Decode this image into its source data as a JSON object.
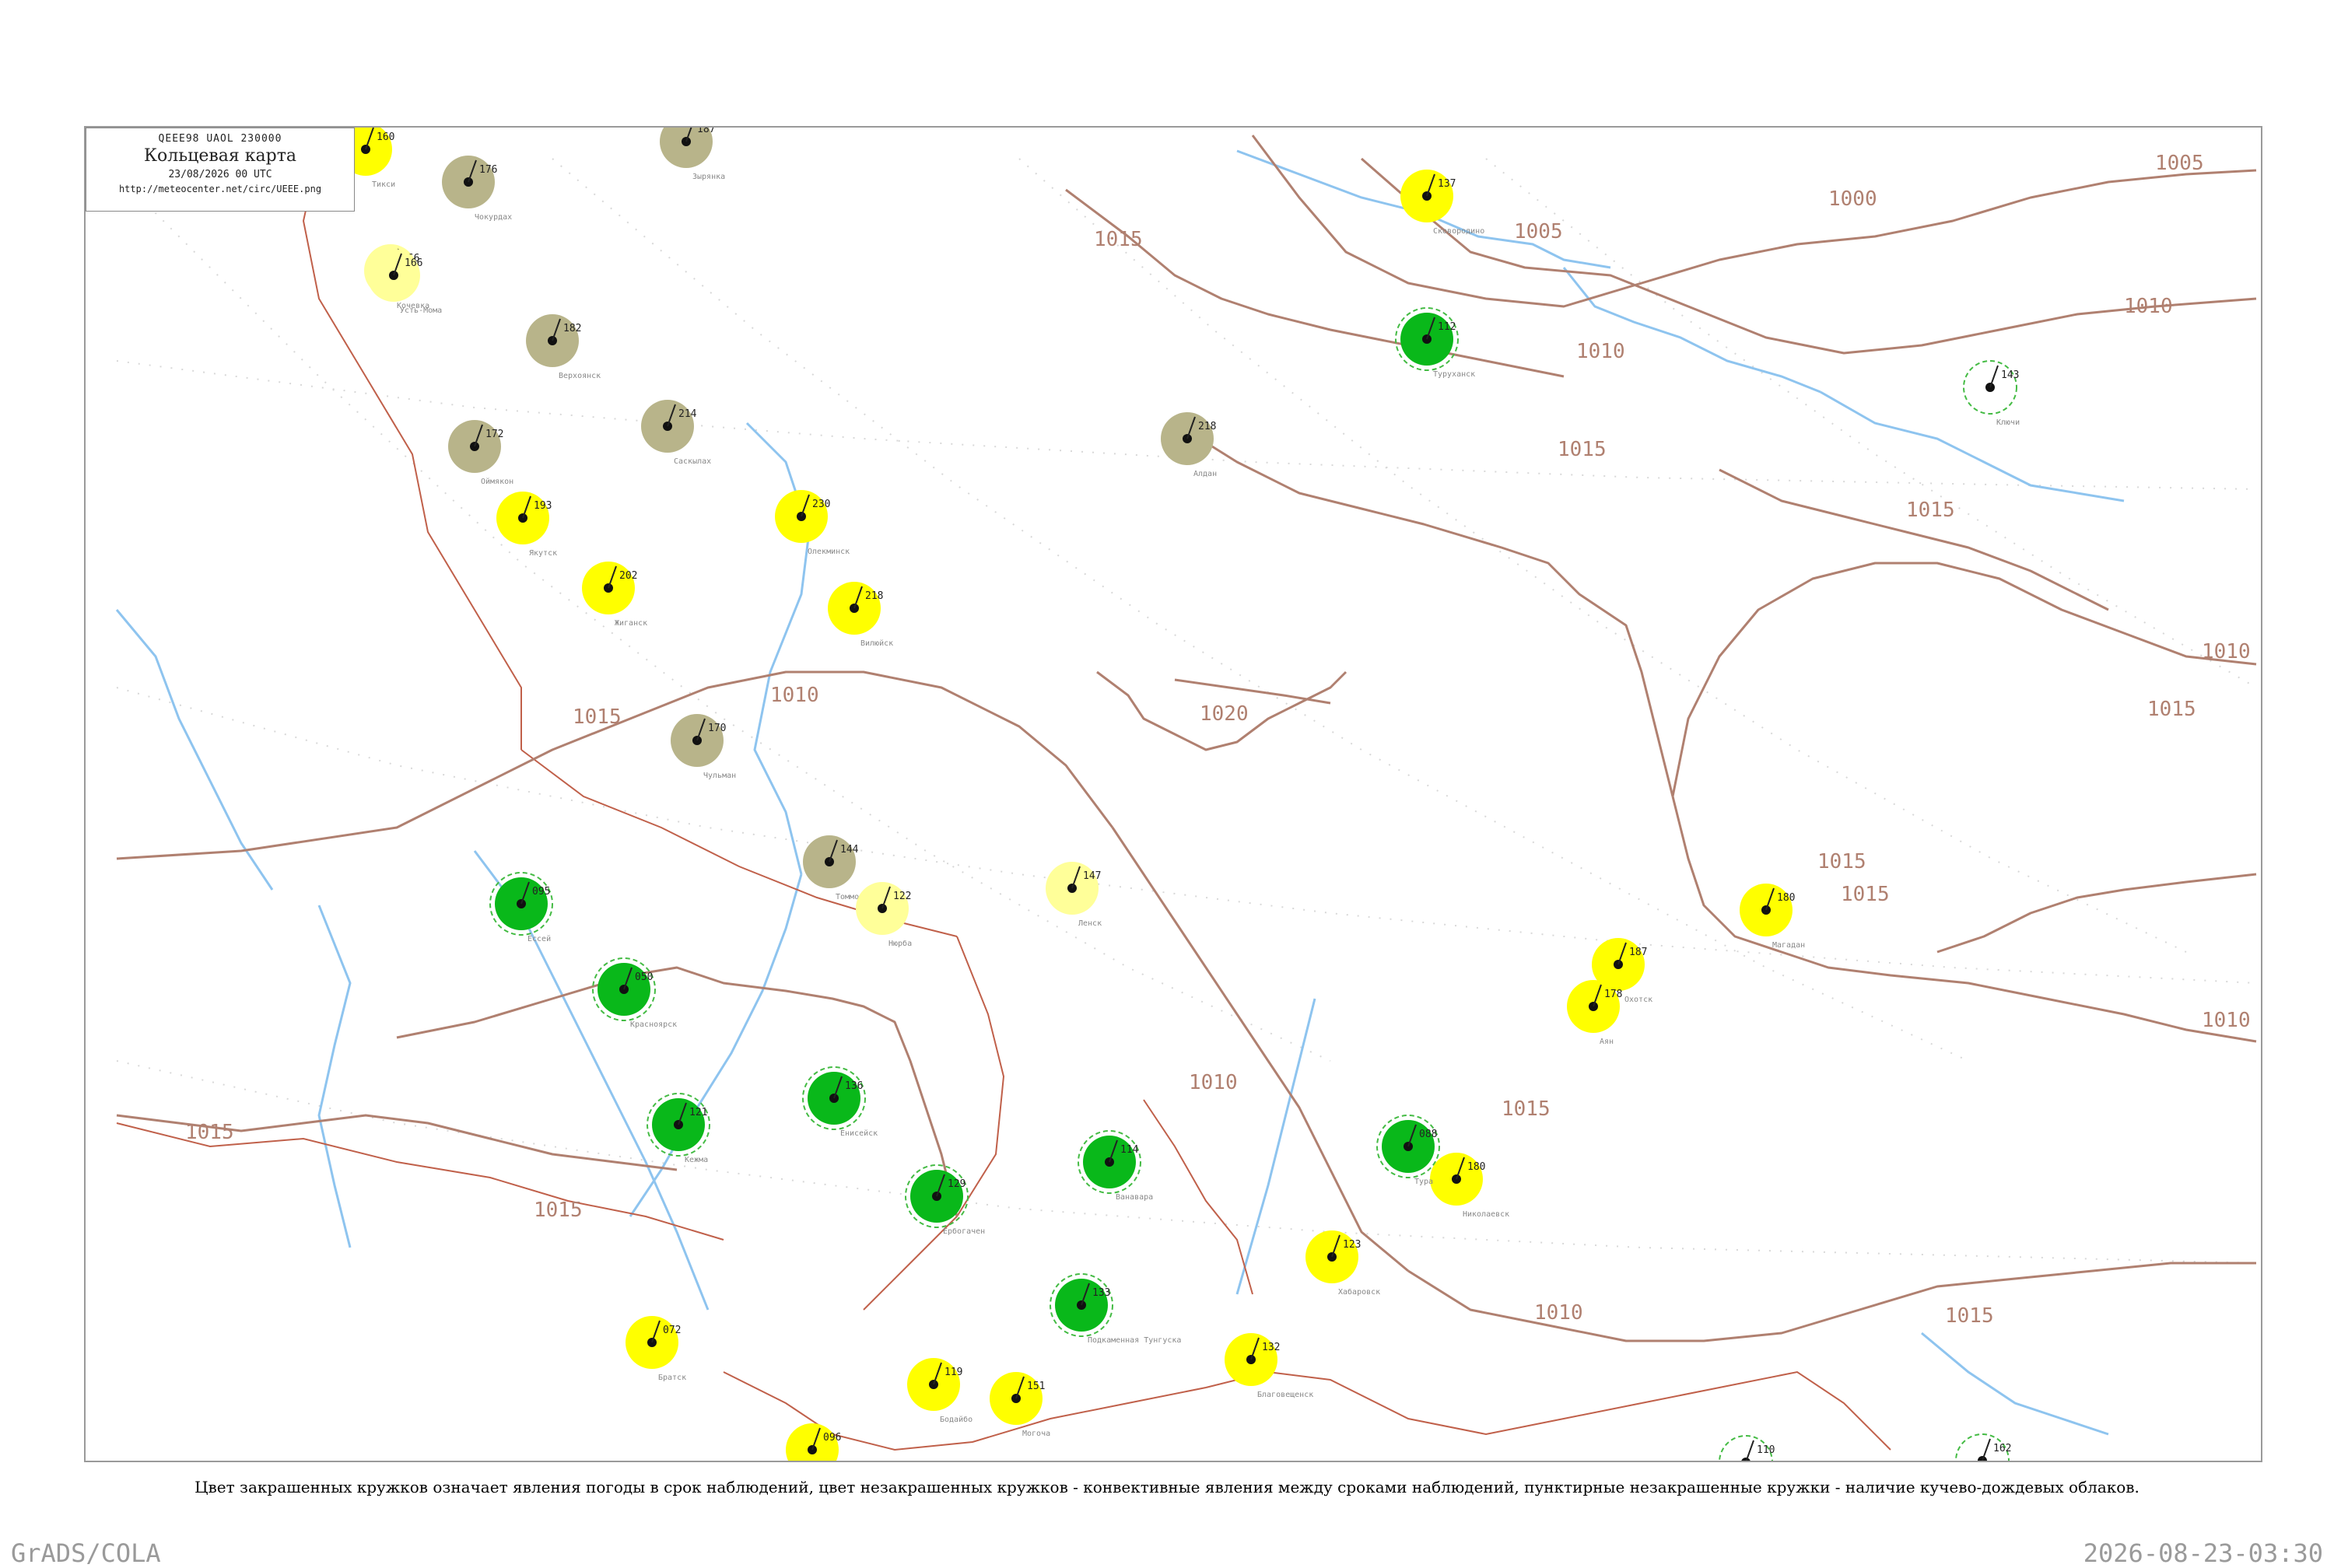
{
  "header": {
    "code": "QEEE98  UAOL  230000",
    "title": "Кольцевая карта",
    "date": "23/08/2026 00 UTC",
    "url": "http://meteocenter.net/circ/UEEE.png"
  },
  "caption": "Цвет закрашенных кружков означает явления погоды в срок наблюдений, цвет незакрашенных кружков - конвективные явления между сроками наблюдений, пунктирные незакрашенные кружки - наличие кучево-дождевых облаков.",
  "footer": {
    "left": "GrADS/COLA",
    "right": "2026-08-23-03:30"
  },
  "colors": {
    "isobar": "#b08070",
    "river": "#8ec4ef",
    "border": "#c0604a",
    "grid": "#d8d8d8",
    "green_fill": "#09b81a",
    "olive_fill": "#b8b48a",
    "yellow_fill": "#ffff00",
    "pale_yellow_fill": "#ffff99",
    "light_green_fill": "#55dd77",
    "dashed_ring": "#44bb44",
    "red_ring": "#dd3333"
  },
  "isobars": [
    "1000",
    "1005",
    "1010",
    "1015",
    "1020"
  ],
  "stations": [
    {
      "name": "Тикси",
      "p": "160",
      "fill": "yellow"
    },
    {
      "name": "Кочевка",
      "p": "166",
      "fill": "pale_yellow"
    },
    {
      "name": "Чокурдах",
      "p": "176",
      "fill": "olive"
    },
    {
      "name": "Зырянка",
      "p": "187",
      "fill": "olive"
    },
    {
      "name": "Усть-Мома",
      "p": "166",
      "fill": "pale_yellow"
    },
    {
      "name": "Верхоянск",
      "p": "182",
      "fill": "olive"
    },
    {
      "name": "Саскылах",
      "p": "214",
      "fill": "olive"
    },
    {
      "name": "Оймякон",
      "p": "172",
      "fill": "olive"
    },
    {
      "name": "Якутск",
      "p": "193",
      "fill": "yellow"
    },
    {
      "name": "Олекминск",
      "p": "230",
      "fill": "yellow"
    },
    {
      "name": "Вилюйск",
      "p": "218",
      "fill": "yellow"
    },
    {
      "name": "Жиганск",
      "p": "202",
      "fill": "yellow"
    },
    {
      "name": "Алдан",
      "p": "218",
      "fill": "olive"
    },
    {
      "name": "Чульман",
      "p": "170",
      "fill": "olive"
    },
    {
      "name": "Томмот",
      "p": "144",
      "fill": "olive"
    },
    {
      "name": "Нюрба",
      "p": "122",
      "fill": "pale_yellow"
    },
    {
      "name": "Ленск",
      "p": "147",
      "fill": "pale_yellow"
    },
    {
      "name": "Магадан",
      "p": "180",
      "fill": "yellow"
    },
    {
      "name": "Охотск",
      "p": "187",
      "fill": "yellow"
    },
    {
      "name": "Аян",
      "p": "178",
      "fill": "yellow"
    },
    {
      "name": "Николаевск",
      "p": "180",
      "fill": "yellow"
    },
    {
      "name": "Хабаровск",
      "p": "123",
      "fill": "yellow"
    },
    {
      "name": "Благовещенск",
      "p": "132",
      "fill": "yellow"
    },
    {
      "name": "Чита",
      "p": "096",
      "fill": "yellow"
    },
    {
      "name": "Иркутск",
      "p": "103",
      "fill": "yellow"
    },
    {
      "name": "Братск",
      "p": "072",
      "fill": "yellow"
    },
    {
      "name": "Бодайбо",
      "p": "119",
      "fill": "yellow"
    },
    {
      "name": "Могоча",
      "p": "151",
      "fill": "yellow"
    },
    {
      "name": "Сковородино",
      "p": "137",
      "fill": "yellow"
    },
    {
      "name": "Туруханск",
      "p": "112",
      "fill": "green"
    },
    {
      "name": "Ванавара",
      "p": "114",
      "fill": "green"
    },
    {
      "name": "Ербогачен",
      "p": "129",
      "fill": "green"
    },
    {
      "name": "Енисейск",
      "p": "136",
      "fill": "green"
    },
    {
      "name": "Красноярск",
      "p": "050",
      "fill": "green"
    },
    {
      "name": "Кежма",
      "p": "121",
      "fill": "green"
    },
    {
      "name": "Подкаменная Тунгуска",
      "p": "133",
      "fill": "green"
    },
    {
      "name": "Тура",
      "p": "088",
      "fill": "green"
    },
    {
      "name": "Ессей",
      "p": "095",
      "fill": "green"
    },
    {
      "name": "Ключи",
      "p": "143",
      "fill": "none"
    },
    {
      "name": "Петропавловск",
      "p": "162",
      "fill": "none"
    },
    {
      "name": "Южно-Сахалинск",
      "p": "110",
      "fill": "none"
    }
  ]
}
